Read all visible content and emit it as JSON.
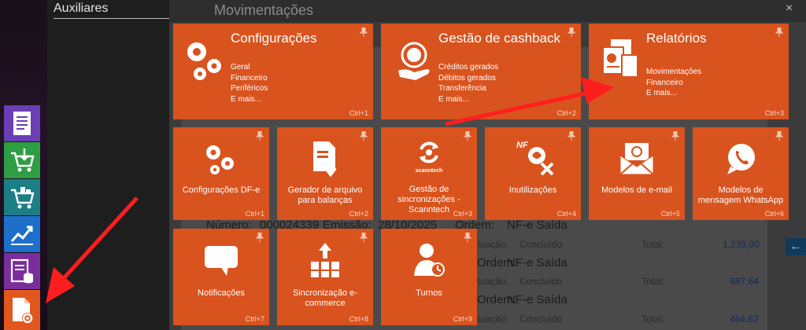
{
  "side_panel": {
    "title": "Auxiliares"
  },
  "background_window": {
    "title": "Movimentações",
    "close_label": "×",
    "rows": [
      {
        "prefix": "Número:",
        "number": "000024339",
        "emissao_label": "Emissão:",
        "date": "28/10/2025",
        "origem_label": "Ordem:",
        "tipo": "NF-e Saída"
      },
      {
        "origem_label": "Ordem:",
        "tipo": "NF-e Saída"
      },
      {
        "origem_label": "Ordem:",
        "tipo": "NF-e Saída"
      }
    ],
    "status_rows": [
      {
        "situacao_label": "Situação:",
        "situacao": "Concluído",
        "total_label": "Total:",
        "total": "1.239,00"
      },
      {
        "situacao_label": "Situação:",
        "situacao": "Concluído",
        "total_label": "Total:",
        "total": "687,64"
      },
      {
        "situacao_label": "Situação:",
        "situacao": "Concluído",
        "total_label": "Total:",
        "total": "464,62"
      }
    ],
    "back_button": "←"
  },
  "tiles": {
    "configuracoes": {
      "title": "Configurações",
      "lines": [
        "Geral",
        "Financeiro",
        "Periféricos",
        "E mais..."
      ],
      "shortcut": "Ctrl+1"
    },
    "cashback": {
      "title": "Gestão de cashback",
      "lines": [
        "Créditos gerados",
        "Débitos gerados",
        "Transferência",
        "E mais..."
      ],
      "shortcut": "Ctrl+2"
    },
    "relatorios": {
      "title": "Relatórios",
      "lines": [
        "Movimentações",
        "Financeiro",
        "E mais..."
      ],
      "shortcut": "Ctrl+3"
    },
    "config_dfe": {
      "label": "Configurações DF-e",
      "shortcut": "Ctrl+1"
    },
    "gerador": {
      "label": "Gerador de arquivo para balanças",
      "shortcut": "Ctrl+2"
    },
    "sincronizacoes": {
      "label": "Gestão de sincronizações - Scanntech",
      "shortcut": "Ctrl+3",
      "logo_text": "scanntech"
    },
    "inutilizacoes": {
      "label": "Inutilizações",
      "shortcut": "Ctrl+4",
      "icon_text": "NF"
    },
    "email": {
      "label": "Modelos de e-mail",
      "shortcut": "Ctrl+5"
    },
    "whatsapp": {
      "label": "Modelos de mensagem WhatsApp",
      "shortcut": "Ctrl+6"
    },
    "notificacoes": {
      "label": "Notificações",
      "shortcut": "Ctrl+7"
    },
    "ecommerce": {
      "label": "Sincronização e-commerce",
      "shortcut": "Ctrl+8"
    },
    "turnos": {
      "label": "Turnos",
      "shortcut": "Ctrl+9"
    }
  },
  "dock_icons": [
    "document-list-icon",
    "cart-download-icon",
    "cart-items-icon",
    "chart-growth-icon",
    "document-database-icon",
    "document-gear-icon"
  ],
  "colors": {
    "tile": "#d9531e",
    "arrow": "#ff1e1e",
    "dock_purple": "#6a3fb5",
    "dock_green": "#2e9e44",
    "dock_teal": "#1d7f86",
    "dock_blue": "#1e6fc9",
    "dock_violet": "#7a2e9c",
    "dock_orange": "#e2571e"
  }
}
